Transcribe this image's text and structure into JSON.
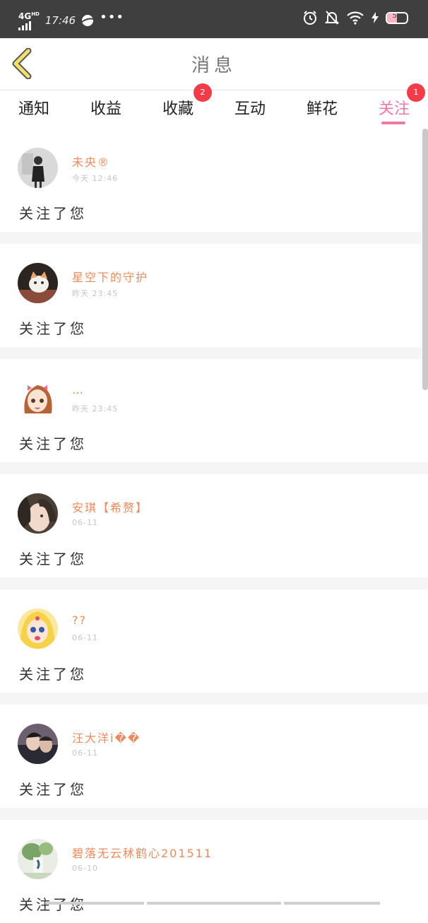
{
  "status_bar": {
    "network": "4G",
    "network_sup": "HD",
    "time": "17:46",
    "more": "•••",
    "battery": "51"
  },
  "header": {
    "title": "消息"
  },
  "tabs": [
    {
      "label": "通知",
      "badge": ""
    },
    {
      "label": "收益",
      "badge": ""
    },
    {
      "label": "收藏",
      "badge": "2"
    },
    {
      "label": "互动",
      "badge": ""
    },
    {
      "label": "鲜花",
      "badge": ""
    },
    {
      "label": "关注",
      "badge": "1",
      "active": true
    }
  ],
  "messages": [
    {
      "name": "未央®",
      "time": "今天 12:46",
      "action": "关注了您"
    },
    {
      "name": "星空下的守护",
      "time": "昨天 23:45",
      "action": "关注了您"
    },
    {
      "name": "…",
      "time": "昨天 23:45",
      "action": "关注了您"
    },
    {
      "name": "安琪【希赘】",
      "time": "06-11",
      "action": "关注了您"
    },
    {
      "name": "??",
      "time": "06-11",
      "action": "关注了您"
    },
    {
      "name": "汪大洋i��",
      "time": "06-11",
      "action": "关注了您"
    },
    {
      "name": "碧落无云秫鹤心201511",
      "time": "06-10",
      "action": "关注了您"
    }
  ],
  "colors": {
    "accent": "#ec7aa3",
    "name": "#e98b60",
    "badge": "#f23c4a",
    "back_arrow": "#f3e06a"
  }
}
